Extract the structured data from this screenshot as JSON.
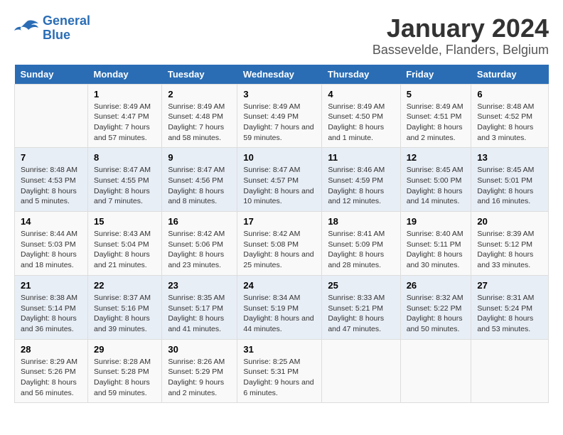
{
  "logo": {
    "line1": "General",
    "line2": "Blue"
  },
  "title": "January 2024",
  "subtitle": "Bassevelde, Flanders, Belgium",
  "weekdays": [
    "Sunday",
    "Monday",
    "Tuesday",
    "Wednesday",
    "Thursday",
    "Friday",
    "Saturday"
  ],
  "weeks": [
    [
      {
        "day": "",
        "sunrise": "",
        "sunset": "",
        "daylight": ""
      },
      {
        "day": "1",
        "sunrise": "Sunrise: 8:49 AM",
        "sunset": "Sunset: 4:47 PM",
        "daylight": "Daylight: 7 hours and 57 minutes."
      },
      {
        "day": "2",
        "sunrise": "Sunrise: 8:49 AM",
        "sunset": "Sunset: 4:48 PM",
        "daylight": "Daylight: 7 hours and 58 minutes."
      },
      {
        "day": "3",
        "sunrise": "Sunrise: 8:49 AM",
        "sunset": "Sunset: 4:49 PM",
        "daylight": "Daylight: 7 hours and 59 minutes."
      },
      {
        "day": "4",
        "sunrise": "Sunrise: 8:49 AM",
        "sunset": "Sunset: 4:50 PM",
        "daylight": "Daylight: 8 hours and 1 minute."
      },
      {
        "day": "5",
        "sunrise": "Sunrise: 8:49 AM",
        "sunset": "Sunset: 4:51 PM",
        "daylight": "Daylight: 8 hours and 2 minutes."
      },
      {
        "day": "6",
        "sunrise": "Sunrise: 8:48 AM",
        "sunset": "Sunset: 4:52 PM",
        "daylight": "Daylight: 8 hours and 3 minutes."
      }
    ],
    [
      {
        "day": "7",
        "sunrise": "Sunrise: 8:48 AM",
        "sunset": "Sunset: 4:53 PM",
        "daylight": "Daylight: 8 hours and 5 minutes."
      },
      {
        "day": "8",
        "sunrise": "Sunrise: 8:47 AM",
        "sunset": "Sunset: 4:55 PM",
        "daylight": "Daylight: 8 hours and 7 minutes."
      },
      {
        "day": "9",
        "sunrise": "Sunrise: 8:47 AM",
        "sunset": "Sunset: 4:56 PM",
        "daylight": "Daylight: 8 hours and 8 minutes."
      },
      {
        "day": "10",
        "sunrise": "Sunrise: 8:47 AM",
        "sunset": "Sunset: 4:57 PM",
        "daylight": "Daylight: 8 hours and 10 minutes."
      },
      {
        "day": "11",
        "sunrise": "Sunrise: 8:46 AM",
        "sunset": "Sunset: 4:59 PM",
        "daylight": "Daylight: 8 hours and 12 minutes."
      },
      {
        "day": "12",
        "sunrise": "Sunrise: 8:45 AM",
        "sunset": "Sunset: 5:00 PM",
        "daylight": "Daylight: 8 hours and 14 minutes."
      },
      {
        "day": "13",
        "sunrise": "Sunrise: 8:45 AM",
        "sunset": "Sunset: 5:01 PM",
        "daylight": "Daylight: 8 hours and 16 minutes."
      }
    ],
    [
      {
        "day": "14",
        "sunrise": "Sunrise: 8:44 AM",
        "sunset": "Sunset: 5:03 PM",
        "daylight": "Daylight: 8 hours and 18 minutes."
      },
      {
        "day": "15",
        "sunrise": "Sunrise: 8:43 AM",
        "sunset": "Sunset: 5:04 PM",
        "daylight": "Daylight: 8 hours and 21 minutes."
      },
      {
        "day": "16",
        "sunrise": "Sunrise: 8:42 AM",
        "sunset": "Sunset: 5:06 PM",
        "daylight": "Daylight: 8 hours and 23 minutes."
      },
      {
        "day": "17",
        "sunrise": "Sunrise: 8:42 AM",
        "sunset": "Sunset: 5:08 PM",
        "daylight": "Daylight: 8 hours and 25 minutes."
      },
      {
        "day": "18",
        "sunrise": "Sunrise: 8:41 AM",
        "sunset": "Sunset: 5:09 PM",
        "daylight": "Daylight: 8 hours and 28 minutes."
      },
      {
        "day": "19",
        "sunrise": "Sunrise: 8:40 AM",
        "sunset": "Sunset: 5:11 PM",
        "daylight": "Daylight: 8 hours and 30 minutes."
      },
      {
        "day": "20",
        "sunrise": "Sunrise: 8:39 AM",
        "sunset": "Sunset: 5:12 PM",
        "daylight": "Daylight: 8 hours and 33 minutes."
      }
    ],
    [
      {
        "day": "21",
        "sunrise": "Sunrise: 8:38 AM",
        "sunset": "Sunset: 5:14 PM",
        "daylight": "Daylight: 8 hours and 36 minutes."
      },
      {
        "day": "22",
        "sunrise": "Sunrise: 8:37 AM",
        "sunset": "Sunset: 5:16 PM",
        "daylight": "Daylight: 8 hours and 39 minutes."
      },
      {
        "day": "23",
        "sunrise": "Sunrise: 8:35 AM",
        "sunset": "Sunset: 5:17 PM",
        "daylight": "Daylight: 8 hours and 41 minutes."
      },
      {
        "day": "24",
        "sunrise": "Sunrise: 8:34 AM",
        "sunset": "Sunset: 5:19 PM",
        "daylight": "Daylight: 8 hours and 44 minutes."
      },
      {
        "day": "25",
        "sunrise": "Sunrise: 8:33 AM",
        "sunset": "Sunset: 5:21 PM",
        "daylight": "Daylight: 8 hours and 47 minutes."
      },
      {
        "day": "26",
        "sunrise": "Sunrise: 8:32 AM",
        "sunset": "Sunset: 5:22 PM",
        "daylight": "Daylight: 8 hours and 50 minutes."
      },
      {
        "day": "27",
        "sunrise": "Sunrise: 8:31 AM",
        "sunset": "Sunset: 5:24 PM",
        "daylight": "Daylight: 8 hours and 53 minutes."
      }
    ],
    [
      {
        "day": "28",
        "sunrise": "Sunrise: 8:29 AM",
        "sunset": "Sunset: 5:26 PM",
        "daylight": "Daylight: 8 hours and 56 minutes."
      },
      {
        "day": "29",
        "sunrise": "Sunrise: 8:28 AM",
        "sunset": "Sunset: 5:28 PM",
        "daylight": "Daylight: 8 hours and 59 minutes."
      },
      {
        "day": "30",
        "sunrise": "Sunrise: 8:26 AM",
        "sunset": "Sunset: 5:29 PM",
        "daylight": "Daylight: 9 hours and 2 minutes."
      },
      {
        "day": "31",
        "sunrise": "Sunrise: 8:25 AM",
        "sunset": "Sunset: 5:31 PM",
        "daylight": "Daylight: 9 hours and 6 minutes."
      },
      {
        "day": "",
        "sunrise": "",
        "sunset": "",
        "daylight": ""
      },
      {
        "day": "",
        "sunrise": "",
        "sunset": "",
        "daylight": ""
      },
      {
        "day": "",
        "sunrise": "",
        "sunset": "",
        "daylight": ""
      }
    ]
  ]
}
